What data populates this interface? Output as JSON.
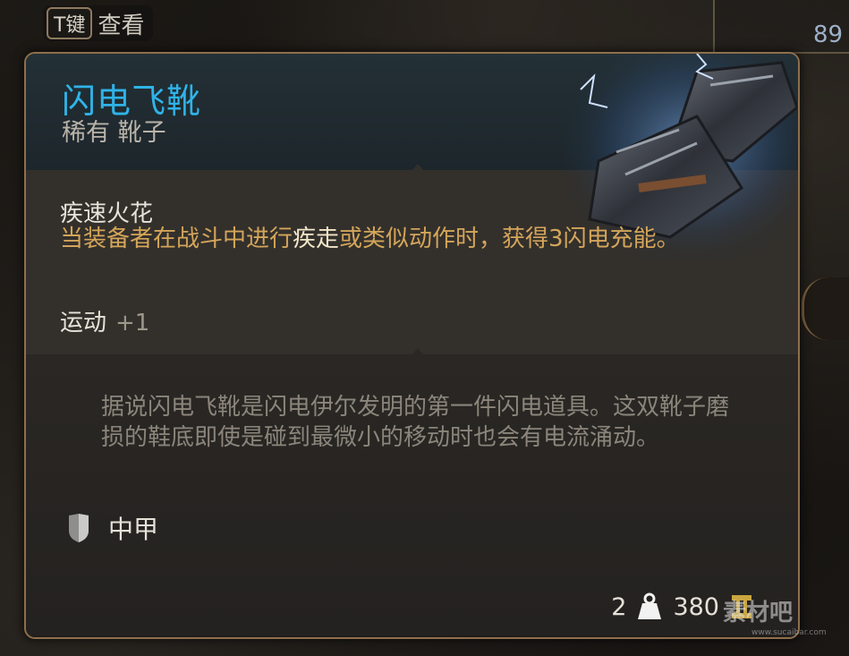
{
  "hint": {
    "key_label": "T键",
    "label": "查看"
  },
  "stack_count": "89",
  "item": {
    "name": "闪电飞靴",
    "type": "稀有 靴子",
    "property": {
      "name": "疾速火花",
      "desc_before": "当装备者在战斗中进行",
      "desc_highlight": "疾走",
      "desc_after": "或类似动作时，获得3闪电充能。"
    },
    "bonus": {
      "label": "运动",
      "value": "+1"
    },
    "lore": "据说闪电飞靴是闪电伊尔发明的第一件闪电道具。这双靴子磨损的鞋底即使是碰到最微小的移动时也会有电流涌动。",
    "armor_type": "中甲",
    "weight": "2",
    "value": "380",
    "icons": {
      "armor": "shield-icon",
      "weight": "weight-icon",
      "value": "coin-icon",
      "art": "boots-art"
    }
  },
  "watermark": {
    "brand": "素材吧",
    "url": "www.sucaibar.com"
  },
  "colors": {
    "name": "#2fb3e8",
    "accent_text": "#d4a55a",
    "border": "#8f6f4c"
  }
}
